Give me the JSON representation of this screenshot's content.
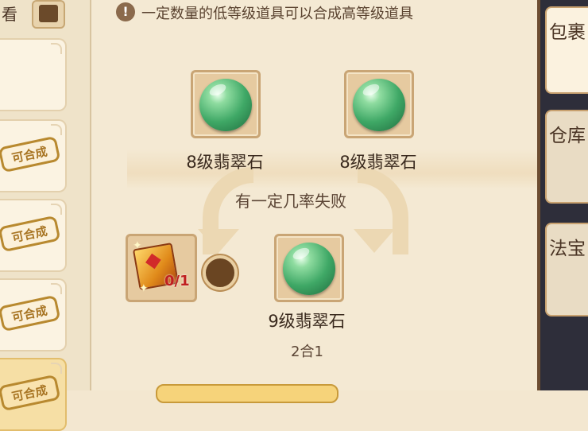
{
  "left_panel": {
    "view_label": "看",
    "slots": [
      {
        "badge": ""
      },
      {
        "badge": "可合成"
      },
      {
        "badge": "可合成"
      },
      {
        "badge": "可合成"
      },
      {
        "badge": "可合成"
      }
    ]
  },
  "main": {
    "hint": "一定数量的低等级道具可以合成高等级道具",
    "inputs": [
      {
        "name": "8级翡翠石",
        "icon": "emerald-orb"
      },
      {
        "name": "8级翡翠石",
        "icon": "emerald-orb"
      }
    ],
    "fail_text": "有一定几率失败",
    "tool": {
      "icon": "treasure-box",
      "ratio": "0/1"
    },
    "output": {
      "name": "9级翡翠石",
      "icon": "emerald-orb"
    },
    "ratio": "2合1"
  },
  "tabs": [
    {
      "label": "包裹"
    },
    {
      "label": "仓库"
    },
    {
      "label": "法宝"
    }
  ],
  "colors": {
    "panel": "#f4e9d3",
    "accent": "#c9a575",
    "stamp": "#b8892f",
    "emerald": "#3fa866"
  }
}
